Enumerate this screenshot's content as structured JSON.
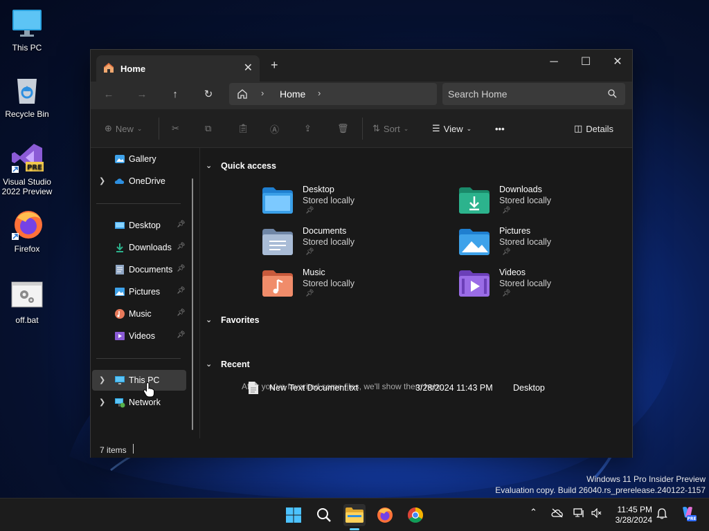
{
  "desktop": {
    "icons": [
      {
        "label": "This PC",
        "icon": "monitor-icon"
      },
      {
        "label": "Recycle Bin",
        "icon": "recycle-bin-icon"
      },
      {
        "label": "Visual Studio 2022 Preview",
        "icon": "visual-studio-icon",
        "badge": "PRE"
      },
      {
        "label": "Firefox",
        "icon": "firefox-icon"
      },
      {
        "label": "off.bat",
        "icon": "batch-file-icon"
      }
    ]
  },
  "window": {
    "tab_title": "Home",
    "new_tab_glyph": "+",
    "address": {
      "segment": "Home"
    },
    "search": {
      "placeholder": "Search Home"
    },
    "toolbar": {
      "new_label": "New",
      "sort_label": "Sort",
      "view_label": "View",
      "more_label": "•••",
      "details_label": "Details"
    },
    "nav": {
      "items": [
        {
          "label": "Gallery",
          "icon": "gallery-icon"
        },
        {
          "label": "OneDrive",
          "icon": "onedrive-icon"
        },
        {
          "label": "Desktop",
          "icon": "desktop-folder-icon"
        },
        {
          "label": "Downloads",
          "icon": "downloads-icon"
        },
        {
          "label": "Documents",
          "icon": "documents-icon"
        },
        {
          "label": "Pictures",
          "icon": "pictures-icon"
        },
        {
          "label": "Music",
          "icon": "music-icon"
        },
        {
          "label": "Videos",
          "icon": "videos-icon"
        },
        {
          "label": "This PC",
          "icon": "this-pc-icon"
        },
        {
          "label": "Network",
          "icon": "network-icon"
        }
      ]
    },
    "quick_access": {
      "heading": "Quick access",
      "items": [
        {
          "name": "Desktop",
          "sub": "Stored locally",
          "color": "#3a9fe8"
        },
        {
          "name": "Downloads",
          "sub": "Stored locally",
          "color": "#2cb38d"
        },
        {
          "name": "Documents",
          "sub": "Stored locally",
          "color": "#8fa6c4"
        },
        {
          "name": "Pictures",
          "sub": "Stored locally",
          "color": "#3ea2ea"
        },
        {
          "name": "Music",
          "sub": "Stored locally",
          "color": "#e8795a"
        },
        {
          "name": "Videos",
          "sub": "Stored locally",
          "color": "#8b5bd6"
        }
      ]
    },
    "favorites": {
      "heading": "Favorites",
      "message": "After you've favorited some files, we'll show them here."
    },
    "recent": {
      "heading": "Recent",
      "rows": [
        {
          "name": "New Text Document.txt",
          "date": "3/28/2024 11:43 PM",
          "location": "Desktop"
        }
      ]
    },
    "status": {
      "count": "7 items"
    }
  },
  "watermark": {
    "line1": "Windows 11 Pro Insider Preview",
    "line2": "Evaluation copy. Build 26040.rs_prerelease.240122-1157"
  },
  "taskbar": {
    "clock_time": "11:45 PM",
    "clock_date": "3/28/2024"
  }
}
